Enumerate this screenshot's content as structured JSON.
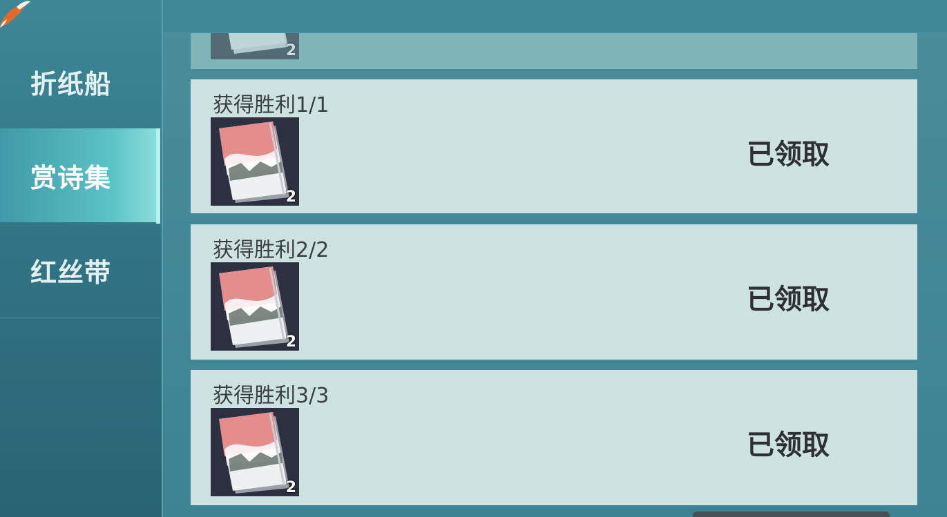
{
  "sidebar": {
    "items": [
      {
        "label": "折纸船",
        "selected": false
      },
      {
        "label": "赏诗集",
        "selected": true
      },
      {
        "label": "红丝带",
        "selected": false
      }
    ]
  },
  "colors": {
    "accent": "#5cc3c6",
    "card_bg": "#cfe2e2",
    "sidebar_bg": "#2f6f80"
  },
  "partial_card": {
    "item_icon": "poetry-book-icon",
    "quantity": "2"
  },
  "tasks": [
    {
      "title": "获得胜利1/1",
      "item_icon": "poetry-book-icon",
      "quantity": "2",
      "status": "已领取"
    },
    {
      "title": "获得胜利2/2",
      "item_icon": "poetry-book-icon",
      "quantity": "2",
      "status": "已领取"
    },
    {
      "title": "获得胜利3/3",
      "item_icon": "poetry-book-icon",
      "quantity": "2",
      "status": "已领取"
    }
  ]
}
